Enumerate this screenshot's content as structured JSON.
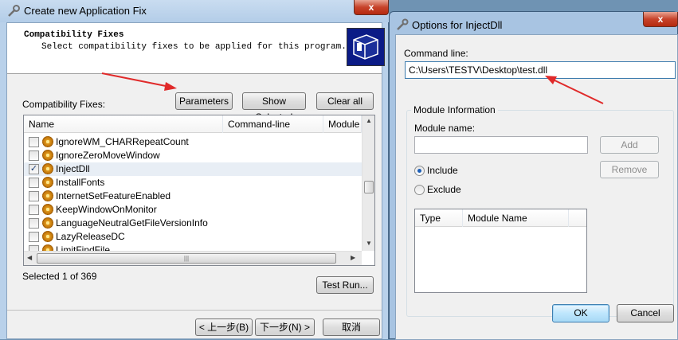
{
  "main_window": {
    "title": "Create new Application Fix",
    "close_glyph": "x",
    "header": {
      "title": "Compatibility Fixes",
      "subtitle": "Select compatibility fixes to be applied for this program."
    },
    "fixes_label": "Compatibility Fixes:",
    "buttons": {
      "parameters": "Parameters",
      "show_selected": "Show Selected",
      "clear_all": "Clear all",
      "test_run": "Test Run...",
      "back": "< 上一步(B)",
      "next": "下一步(N) >",
      "cancel": "取消"
    },
    "list": {
      "columns": [
        "Name",
        "Command-line",
        "Module"
      ],
      "rows": [
        {
          "name": "IgnoreWM_CHARRepeatCount",
          "checked": false,
          "selected": false
        },
        {
          "name": "IgnoreZeroMoveWindow",
          "checked": false,
          "selected": false
        },
        {
          "name": "InjectDll",
          "checked": true,
          "selected": true
        },
        {
          "name": "InstallFonts",
          "checked": false,
          "selected": false
        },
        {
          "name": "InternetSetFeatureEnabled",
          "checked": false,
          "selected": false
        },
        {
          "name": "KeepWindowOnMonitor",
          "checked": false,
          "selected": false
        },
        {
          "name": "LanguageNeutralGetFileVersionInfo",
          "checked": false,
          "selected": false
        },
        {
          "name": "LazyReleaseDC",
          "checked": false,
          "selected": false
        },
        {
          "name": "LimitFindFile",
          "checked": false,
          "selected": false
        }
      ]
    },
    "status": "Selected 1 of 369"
  },
  "options_dialog": {
    "title": "Options for InjectDll",
    "close_glyph": "x",
    "command_line_label": "Command line:",
    "command_line_value": "C:\\Users\\TESTV\\Desktop\\test.dll",
    "module_group_label": "Module Information",
    "module_name_label": "Module name:",
    "module_name_value": "",
    "add_button": "Add",
    "remove_button": "Remove",
    "include_label": "Include",
    "exclude_label": "Exclude",
    "include_selected": true,
    "table_columns": [
      "Type",
      "Module Name"
    ],
    "ok_button": "OK",
    "cancel_button": "Cancel"
  },
  "colors": {
    "annotation_arrow": "#e02a2a",
    "selection": "#e8eef5",
    "window_frame": "#b9d1ea"
  }
}
